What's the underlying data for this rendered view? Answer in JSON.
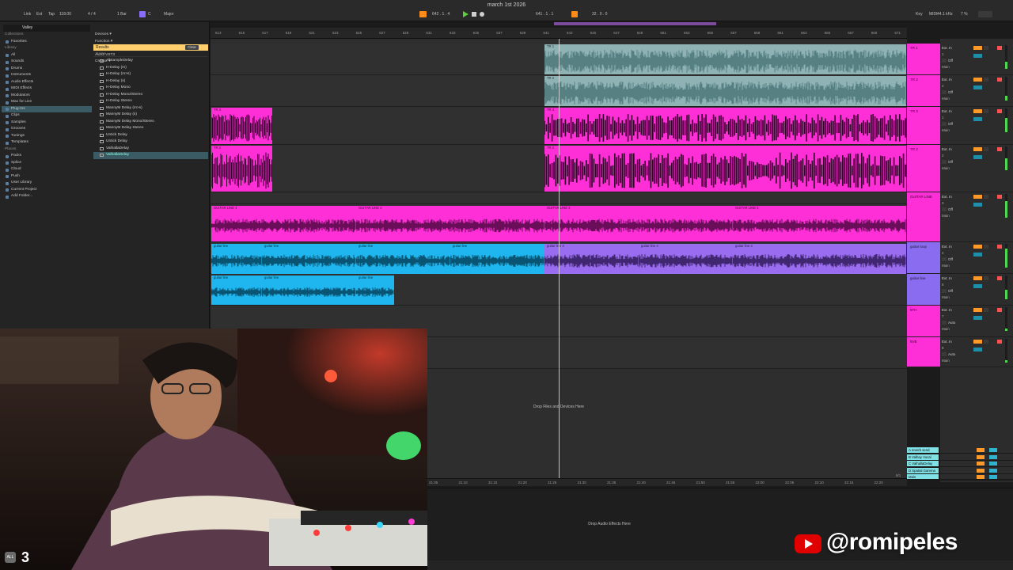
{
  "window": {
    "title": "march 1st 2026"
  },
  "transport": {
    "link": "Link",
    "ext": "Ext",
    "tap": "Tap",
    "tempo": "118.00",
    "signature": "4 / 4",
    "quantize": "1 Bar",
    "key_root": "C",
    "scale": "Major",
    "position": "642 . 1 . 4",
    "loop_start": "641 . 1 . 1",
    "loop_length": "32 . 0 . 0",
    "key_label": "Key",
    "midi_label": "MIDI",
    "sample_rate": "44.1 kHz",
    "cpu": "7 %"
  },
  "browser": {
    "search": "Valley",
    "sidebar": [
      {
        "label": "Collections",
        "head": true
      },
      {
        "label": "Favorites"
      },
      {
        "label": "Library",
        "head": true
      },
      {
        "label": "All"
      },
      {
        "label": "Sounds"
      },
      {
        "label": "Drums"
      },
      {
        "label": "Instruments"
      },
      {
        "label": "Audio Effects"
      },
      {
        "label": "MIDI Effects"
      },
      {
        "label": "Modulators"
      },
      {
        "label": "Max for Live"
      },
      {
        "label": "Plug-Ins",
        "active": true
      },
      {
        "label": "Clips"
      },
      {
        "label": "Samples"
      },
      {
        "label": "Grooves"
      },
      {
        "label": "Tunings"
      },
      {
        "label": "Templates"
      },
      {
        "label": "Places",
        "head": true
      },
      {
        "label": "Packs"
      },
      {
        "label": "Splice"
      },
      {
        "label": "Cloud"
      },
      {
        "label": "Push"
      },
      {
        "label": "User Library"
      },
      {
        "label": "Current Project"
      },
      {
        "label": "Add Folder..."
      }
    ],
    "filters": [
      "Devices ▾",
      "Function ▾",
      "Format ▾",
      "AUv3   VST3",
      "Creator ▾"
    ],
    "results_label": "Results",
    "clear_label": "Clear",
    "name_header": "Name",
    "results": [
      {
        "label": "AllSampleDelay"
      },
      {
        "label": "H-Delay (m)"
      },
      {
        "label": "H-Delay (m>s)"
      },
      {
        "label": "H-Delay (s)"
      },
      {
        "label": "H-Delay Mono"
      },
      {
        "label": "H-Delay Mono/Stereo"
      },
      {
        "label": "H-Delay Stereo"
      },
      {
        "label": "MannyM Delay (m>s)"
      },
      {
        "label": "MannyM Delay (s)"
      },
      {
        "label": "MannyM Delay Mono/Stereo"
      },
      {
        "label": "MannyM Delay Stereo"
      },
      {
        "label": "Untick Delay"
      },
      {
        "label": "Untick Delay"
      },
      {
        "label": "ValhallaDelay"
      },
      {
        "label": "ValhallaDelay",
        "active": true
      }
    ]
  },
  "ruler_labels": [
    "613",
    "615",
    "617",
    "619",
    "621",
    "623",
    "625",
    "627",
    "629",
    "631",
    "633",
    "635",
    "637",
    "639",
    "641",
    "643",
    "645",
    "647",
    "649",
    "651",
    "653",
    "655",
    "657",
    "659",
    "661",
    "663",
    "665",
    "667",
    "669",
    "671"
  ],
  "tracks": [
    {
      "name": "TR 1",
      "color": "#ff2fd7",
      "ext": "Ext. In",
      "chan": "1",
      "input": "In",
      "monitor": "Off",
      "out": "Main",
      "meter": 0.3
    },
    {
      "name": "TR 2",
      "color": "#ff2fd7",
      "ext": "Ext. In",
      "chan": "2",
      "input": "In",
      "monitor": "Off",
      "out": "Main",
      "meter": 0.2
    },
    {
      "name": "TR 3",
      "color": "#ff2fd7",
      "ext": "Ext. In",
      "chan": "1",
      "input": "In",
      "monitor": "Off",
      "out": "Main",
      "meter": 0.6
    },
    {
      "name": "TR 2",
      "color": "#ff2fd7",
      "ext": "Ext. In",
      "chan": "2",
      "input": "In",
      "monitor": "Off",
      "out": "Main",
      "meter": 0.5
    },
    {
      "name": "GUITAR LINE",
      "color": "#ff2fd7",
      "ext": "Ext. In",
      "chan": "3",
      "input": "In",
      "monitor": "Off",
      "out": "Main",
      "meter": 0.7
    },
    {
      "name": "guitar loop",
      "color": "#8a6cf0",
      "ext": "Ext. In",
      "chan": "4",
      "input": "In",
      "monitor": "Off",
      "out": "Main",
      "meter": 0.8
    },
    {
      "name": "guitar line",
      "color": "#8a6cf0",
      "ext": "Ext. In",
      "chan": "5",
      "input": "In",
      "monitor": "Off",
      "out": "Main",
      "meter": 0.4
    },
    {
      "name": "6TH",
      "color": "#ff2fd7",
      "ext": "Ext. In",
      "chan": "7",
      "input": "In",
      "monitor": "Auto",
      "out": "Main",
      "meter": 0.1
    },
    {
      "name": "8VB",
      "color": "#ff2fd7",
      "ext": "Ext. In",
      "chan": "8",
      "input": "In",
      "monitor": "Auto",
      "out": "Main",
      "meter": 0.1
    }
  ],
  "clips": {
    "tr1": "TR 1",
    "tr2": "TR 2",
    "tr3": "TR 3",
    "guitar_line": "GUITAR LINE 4",
    "guitar_line_b": "GUITAR LINE 3",
    "guitar_loop": "guitar line",
    "guitar_loop_b": "guitar line 4"
  },
  "drop_files": "Drop Files and Devices Here",
  "drop_effects": "Drop Audio Effects Here",
  "returns": [
    {
      "name": "A reverb send",
      "color": "#7fe0e6"
    },
    {
      "name": "B Valhay Vocal",
      "color": "#7fe0e6"
    },
    {
      "name": "C ValhallaDelay",
      "color": "#7fe0e6"
    },
    {
      "name": "D Spatial Gamma",
      "color": "#7fe0e6"
    },
    {
      "name": "Main",
      "color": "#7fe0e6"
    }
  ],
  "master_counter": "8/1",
  "time_labels": [
    "21:05",
    "21:10",
    "21:15",
    "21:20",
    "21:25",
    "21:30",
    "21:35",
    "21:40",
    "21:45",
    "21:50",
    "21:55",
    "22:00",
    "22:05",
    "22:10",
    "22:15",
    "22:20"
  ],
  "webcam": {
    "badge": "ALL",
    "number": "3"
  },
  "watermark": {
    "handle": "@romipeles"
  },
  "colors": {
    "accent": "#ff8c1a",
    "pink_clip": "#ff2fd7",
    "blue_clip": "#1fb6f0",
    "purple_clip": "#9a6cf0",
    "teal_clip": "#8fb3b5"
  }
}
